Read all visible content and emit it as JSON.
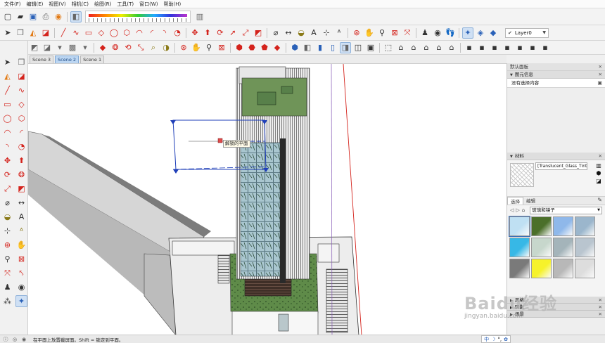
{
  "menu": [
    "文件(F)",
    "编辑(E)",
    "视图(V)",
    "相机(C)",
    "绘图(R)",
    "工具(T)",
    "窗口(W)",
    "帮助(H)"
  ],
  "layer": {
    "value": "Layer0"
  },
  "scenes": [
    {
      "label": "Scene 3",
      "active": false
    },
    {
      "label": "Scene 2",
      "active": true
    },
    {
      "label": "Scene 1",
      "active": false
    }
  ],
  "viewport": {
    "tooltip": "解锁的平面"
  },
  "tray": {
    "title": "默认面板",
    "entity_info": {
      "title": "图元信息",
      "content": "没有选择内容"
    },
    "materials": {
      "title": "材料",
      "name": "[Translucent_Glass_Tinted]",
      "tabs": [
        "选择",
        "编辑"
      ],
      "collection": "玻璃和镜子",
      "swatch_colors": [
        "#bfe0f3",
        "#4b6f2a",
        "#8fb8ea",
        "#9bb6cc",
        "#37b8e6",
        "#c7d7cc",
        "#a4b4ba",
        "#b9c5cf",
        "#7a7a7a",
        "#f6f22a",
        "#b8b8b8",
        "#dddddd"
      ]
    },
    "collapsed_sections": [
      "风格",
      "阴影",
      "场景"
    ]
  },
  "status": {
    "message": "在平面上放置截屏面。Shift = 锁定到平面。"
  },
  "ime": [
    "中",
    "☽",
    "°,",
    "✿"
  ],
  "watermark": {
    "logo": "Baidu经验",
    "sub": "jingyan.baidu.com"
  }
}
